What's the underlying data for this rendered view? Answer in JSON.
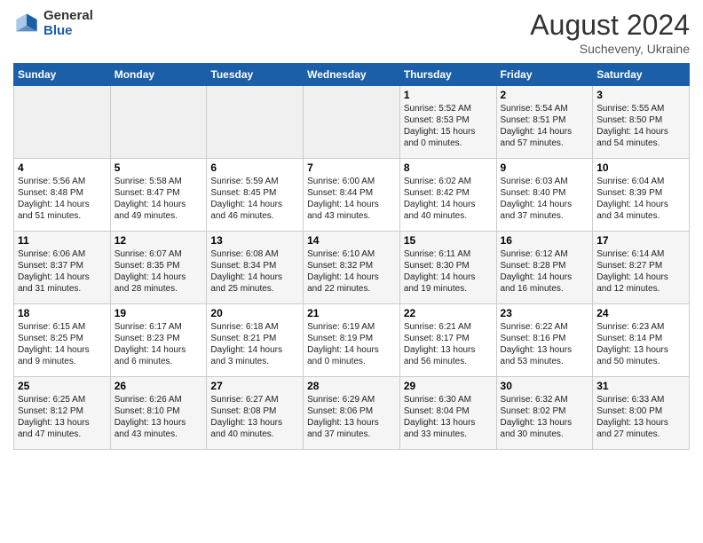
{
  "header": {
    "logo_general": "General",
    "logo_blue": "Blue",
    "month_year": "August 2024",
    "location": "Sucheveny, Ukraine"
  },
  "calendar": {
    "days_of_week": [
      "Sunday",
      "Monday",
      "Tuesday",
      "Wednesday",
      "Thursday",
      "Friday",
      "Saturday"
    ],
    "weeks": [
      [
        {
          "day": "",
          "content": ""
        },
        {
          "day": "",
          "content": ""
        },
        {
          "day": "",
          "content": ""
        },
        {
          "day": "",
          "content": ""
        },
        {
          "day": "1",
          "content": "Sunrise: 5:52 AM\nSunset: 8:53 PM\nDaylight: 15 hours and 0 minutes."
        },
        {
          "day": "2",
          "content": "Sunrise: 5:54 AM\nSunset: 8:51 PM\nDaylight: 14 hours and 57 minutes."
        },
        {
          "day": "3",
          "content": "Sunrise: 5:55 AM\nSunset: 8:50 PM\nDaylight: 14 hours and 54 minutes."
        }
      ],
      [
        {
          "day": "4",
          "content": "Sunrise: 5:56 AM\nSunset: 8:48 PM\nDaylight: 14 hours and 51 minutes."
        },
        {
          "day": "5",
          "content": "Sunrise: 5:58 AM\nSunset: 8:47 PM\nDaylight: 14 hours and 49 minutes."
        },
        {
          "day": "6",
          "content": "Sunrise: 5:59 AM\nSunset: 8:45 PM\nDaylight: 14 hours and 46 minutes."
        },
        {
          "day": "7",
          "content": "Sunrise: 6:00 AM\nSunset: 8:44 PM\nDaylight: 14 hours and 43 minutes."
        },
        {
          "day": "8",
          "content": "Sunrise: 6:02 AM\nSunset: 8:42 PM\nDaylight: 14 hours and 40 minutes."
        },
        {
          "day": "9",
          "content": "Sunrise: 6:03 AM\nSunset: 8:40 PM\nDaylight: 14 hours and 37 minutes."
        },
        {
          "day": "10",
          "content": "Sunrise: 6:04 AM\nSunset: 8:39 PM\nDaylight: 14 hours and 34 minutes."
        }
      ],
      [
        {
          "day": "11",
          "content": "Sunrise: 6:06 AM\nSunset: 8:37 PM\nDaylight: 14 hours and 31 minutes."
        },
        {
          "day": "12",
          "content": "Sunrise: 6:07 AM\nSunset: 8:35 PM\nDaylight: 14 hours and 28 minutes."
        },
        {
          "day": "13",
          "content": "Sunrise: 6:08 AM\nSunset: 8:34 PM\nDaylight: 14 hours and 25 minutes."
        },
        {
          "day": "14",
          "content": "Sunrise: 6:10 AM\nSunset: 8:32 PM\nDaylight: 14 hours and 22 minutes."
        },
        {
          "day": "15",
          "content": "Sunrise: 6:11 AM\nSunset: 8:30 PM\nDaylight: 14 hours and 19 minutes."
        },
        {
          "day": "16",
          "content": "Sunrise: 6:12 AM\nSunset: 8:28 PM\nDaylight: 14 hours and 16 minutes."
        },
        {
          "day": "17",
          "content": "Sunrise: 6:14 AM\nSunset: 8:27 PM\nDaylight: 14 hours and 12 minutes."
        }
      ],
      [
        {
          "day": "18",
          "content": "Sunrise: 6:15 AM\nSunset: 8:25 PM\nDaylight: 14 hours and 9 minutes."
        },
        {
          "day": "19",
          "content": "Sunrise: 6:17 AM\nSunset: 8:23 PM\nDaylight: 14 hours and 6 minutes."
        },
        {
          "day": "20",
          "content": "Sunrise: 6:18 AM\nSunset: 8:21 PM\nDaylight: 14 hours and 3 minutes."
        },
        {
          "day": "21",
          "content": "Sunrise: 6:19 AM\nSunset: 8:19 PM\nDaylight: 14 hours and 0 minutes."
        },
        {
          "day": "22",
          "content": "Sunrise: 6:21 AM\nSunset: 8:17 PM\nDaylight: 13 hours and 56 minutes."
        },
        {
          "day": "23",
          "content": "Sunrise: 6:22 AM\nSunset: 8:16 PM\nDaylight: 13 hours and 53 minutes."
        },
        {
          "day": "24",
          "content": "Sunrise: 6:23 AM\nSunset: 8:14 PM\nDaylight: 13 hours and 50 minutes."
        }
      ],
      [
        {
          "day": "25",
          "content": "Sunrise: 6:25 AM\nSunset: 8:12 PM\nDaylight: 13 hours and 47 minutes."
        },
        {
          "day": "26",
          "content": "Sunrise: 6:26 AM\nSunset: 8:10 PM\nDaylight: 13 hours and 43 minutes."
        },
        {
          "day": "27",
          "content": "Sunrise: 6:27 AM\nSunset: 8:08 PM\nDaylight: 13 hours and 40 minutes."
        },
        {
          "day": "28",
          "content": "Sunrise: 6:29 AM\nSunset: 8:06 PM\nDaylight: 13 hours and 37 minutes."
        },
        {
          "day": "29",
          "content": "Sunrise: 6:30 AM\nSunset: 8:04 PM\nDaylight: 13 hours and 33 minutes."
        },
        {
          "day": "30",
          "content": "Sunrise: 6:32 AM\nSunset: 8:02 PM\nDaylight: 13 hours and 30 minutes."
        },
        {
          "day": "31",
          "content": "Sunrise: 6:33 AM\nSunset: 8:00 PM\nDaylight: 13 hours and 27 minutes."
        }
      ]
    ]
  }
}
